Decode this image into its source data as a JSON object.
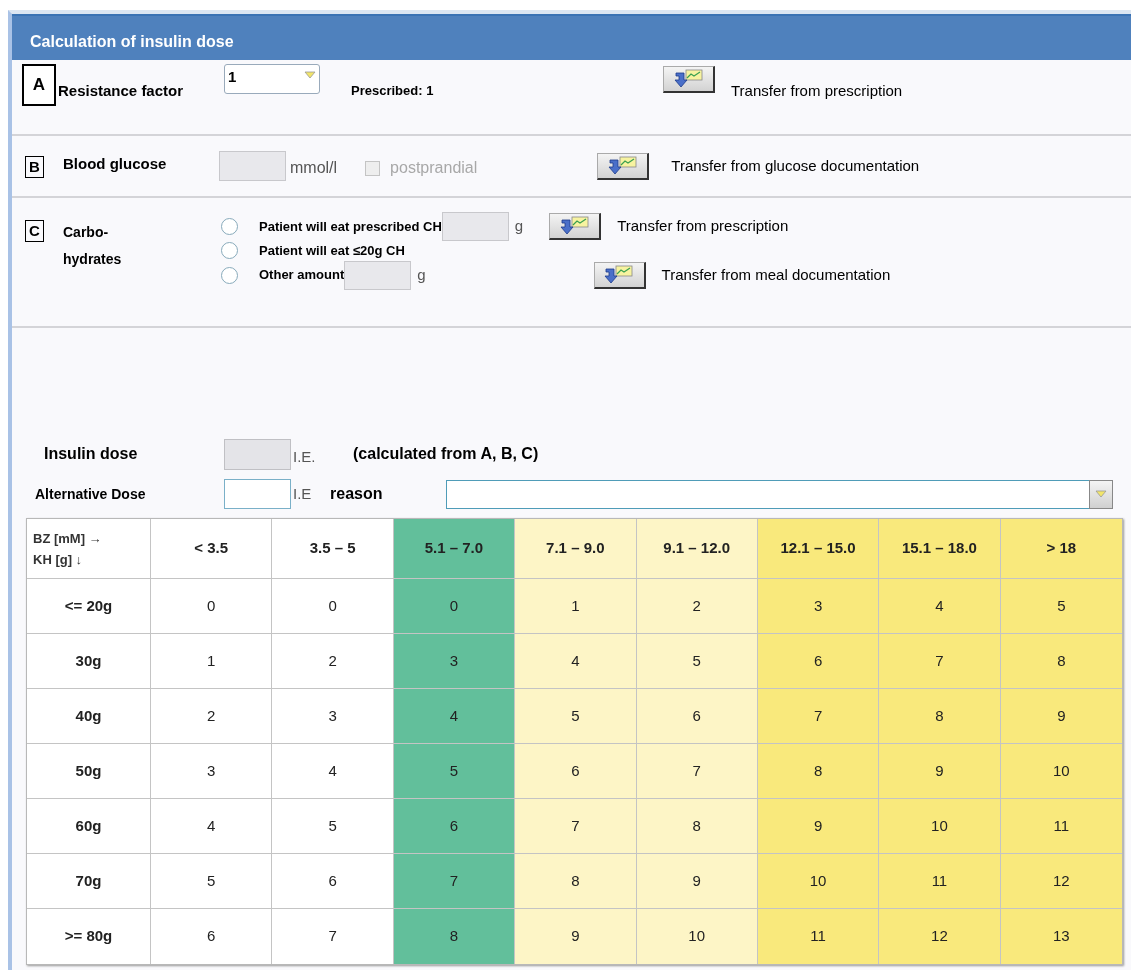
{
  "header": {
    "title": "Calculation of insulin dose"
  },
  "section_a": {
    "letter": "A",
    "label": "Resistance factor",
    "select": {
      "value": "1"
    },
    "prescribed": "Prescribed: 1",
    "transfer": "Transfer from prescription"
  },
  "section_b": {
    "letter": "B",
    "label": "Blood glucose",
    "unit": "mmol/l",
    "checkbox": {
      "label": "postprandial",
      "checked": false,
      "disabled": true
    },
    "transfer": "Transfer from glucose documentation"
  },
  "section_c": {
    "letter": "C",
    "label_lines": [
      "Carbo-",
      "hydrates"
    ],
    "options": [
      {
        "label": "Patient will eat prescribed CH",
        "selected": false,
        "unit": "g",
        "transfer": "Transfer from prescription"
      },
      {
        "label": "Patient will eat ≤20g CH",
        "selected": false
      },
      {
        "label": "Other amount",
        "selected": false,
        "unit": "g",
        "transfer": "Transfer from meal documentation"
      }
    ]
  },
  "insulin_dose": {
    "label": "Insulin dose",
    "unit": "I.E.",
    "note": "(calculated from A, B, C)"
  },
  "alternative_dose": {
    "label": "Alternative Dose",
    "unit": "I.E",
    "reason_label": "reason"
  },
  "table": {
    "corner": [
      "BZ [mM] →",
      "KH [g] ↓"
    ],
    "columns": [
      {
        "label": "< 3.5",
        "color": "#ffffff"
      },
      {
        "label": "3.5 – 5",
        "color": "#ffffff"
      },
      {
        "label": "5.1 – 7.0",
        "color": "#62bf9b"
      },
      {
        "label": "7.1 – 9.0",
        "color": "#fdf5c6"
      },
      {
        "label": "9.1 – 12.0",
        "color": "#fdf5c6"
      },
      {
        "label": "12.1 – 15.0",
        "color": "#f9e97c"
      },
      {
        "label": "15.1 – 18.0",
        "color": "#f9e97c"
      },
      {
        "label": "> 18",
        "color": "#f9e97c"
      }
    ],
    "rows": [
      {
        "label": "<= 20g",
        "values": [
          "0",
          "0",
          "0",
          "1",
          "2",
          "3",
          "4",
          "5"
        ]
      },
      {
        "label": "30g",
        "values": [
          "1",
          "2",
          "3",
          "4",
          "5",
          "6",
          "7",
          "8"
        ]
      },
      {
        "label": "40g",
        "values": [
          "2",
          "3",
          "4",
          "5",
          "6",
          "7",
          "8",
          "9"
        ]
      },
      {
        "label": "50g",
        "values": [
          "3",
          "4",
          "5",
          "6",
          "7",
          "8",
          "9",
          "10"
        ]
      },
      {
        "label": "60g",
        "values": [
          "4",
          "5",
          "6",
          "7",
          "8",
          "9",
          "10",
          "11"
        ]
      },
      {
        "label": "70g",
        "values": [
          "5",
          "6",
          "7",
          "8",
          "9",
          "10",
          "11",
          "12"
        ]
      },
      {
        "label": ">= 80g",
        "values": [
          "6",
          "7",
          "8",
          "9",
          "10",
          "11",
          "12",
          "13"
        ]
      }
    ]
  }
}
